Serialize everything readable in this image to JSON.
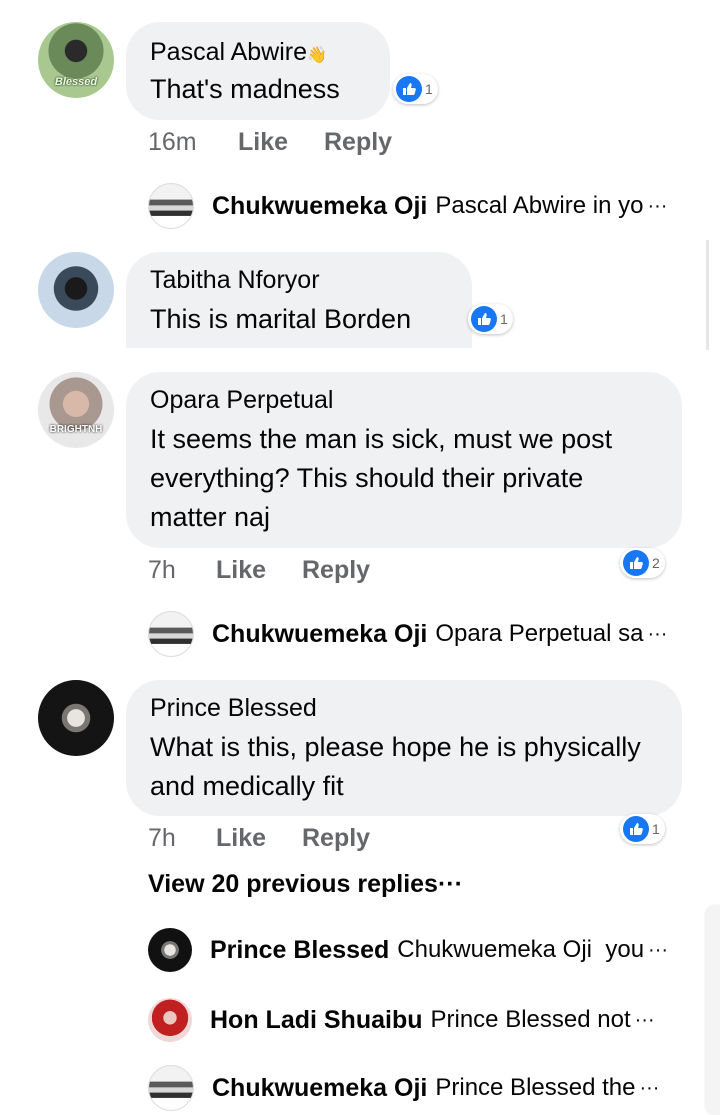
{
  "comments": [
    {
      "author": "Pascal Abwire",
      "author_emoji": "👋",
      "avatar_caption": "Blessed",
      "text": "That's madness",
      "likes": "1",
      "time": "16m",
      "like_label": "Like",
      "reply_label": "Reply",
      "reply_preview": {
        "author": "Chukwuemeka Oji",
        "snippet": "Pascal Abwire in yo",
        "ellipsis": "···"
      }
    },
    {
      "author": "Tabitha Nforyor",
      "text": "This is marital Borden",
      "likes": "1"
    },
    {
      "author": "Opara Perpetual",
      "avatar_caption": "BRIGHTNH",
      "text": "It seems the man is sick, must we post everything? This should their private matter naj",
      "likes": "2",
      "time": "7h",
      "like_label": "Like",
      "reply_label": "Reply",
      "reply_preview": {
        "author": "Chukwuemeka Oji",
        "snippet": "Opara Perpetual sa",
        "ellipsis": "···"
      }
    },
    {
      "author": "Prince Blessed",
      "text": "What is this, please hope he is physically and medically fit",
      "likes": "1",
      "time": "7h",
      "like_label": "Like",
      "reply_label": "Reply",
      "view_previous": "View 20 previous replies···",
      "replies": [
        {
          "author": "Prince Blessed",
          "snippet": "Chukwuemeka Oji  you",
          "ellipsis": "···"
        },
        {
          "author": "Hon Ladi Shuaibu",
          "snippet": "Prince Blessed not",
          "ellipsis": "···"
        },
        {
          "author": "Chukwuemeka Oji",
          "snippet": "Prince Blessed the",
          "ellipsis": "···"
        }
      ]
    }
  ],
  "colors": {
    "bubble": "#eff1f3",
    "meta_text": "#65676b",
    "like_blue": "#1877f2"
  },
  "icons": {
    "like": "thumbs-up-icon",
    "wave": "waving-hand-icon"
  }
}
